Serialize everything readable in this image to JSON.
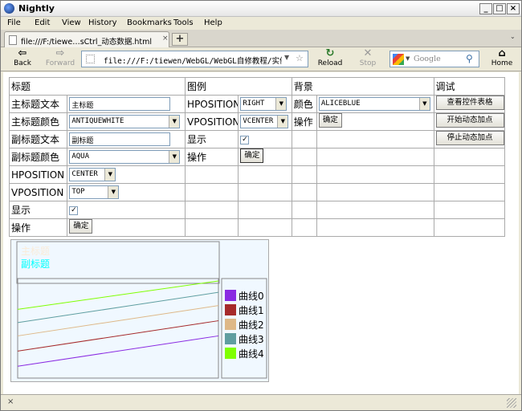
{
  "window": {
    "title": "Nightly",
    "min": "_",
    "max": "□",
    "close": "×"
  },
  "menu": [
    "File",
    "Edit",
    "View",
    "History",
    "Bookmarks",
    "Tools",
    "Help"
  ],
  "tab": {
    "title": "file:///F:/tiewe…sCtrl_动态数据.html",
    "close": "×",
    "new": "+",
    "list": "⌄"
  },
  "nav": {
    "back": "Back",
    "forward": "Forward",
    "reload": "Reload",
    "stop": "Stop",
    "home": "Home",
    "url": "file:///F:/tiewen/WebGL/WebGL自修教程/实例/C",
    "search_placeholder": "Google"
  },
  "headers": {
    "title": "标题",
    "legend": "图例",
    "background": "背景",
    "debug": "调试"
  },
  "title_rows": {
    "main_text_label": "主标题文本",
    "main_text_value": "主标题",
    "main_color_label": "主标题颜色",
    "main_color_value": "ANTIQUEWHITE",
    "sub_text_label": "副标题文本",
    "sub_text_value": "副标题",
    "sub_color_label": "副标题颜色",
    "sub_color_value": "AQUA",
    "hpos_label": "HPOSITION",
    "hpos_value": "CENTER",
    "vpos_label": "VPOSITION",
    "vpos_value": "TOP",
    "show_label": "显示",
    "show_checked": true,
    "op_label": "操作",
    "op_button": "确定"
  },
  "legend_rows": {
    "hpos_label": "HPOSITION",
    "hpos_value": "RIGHT",
    "vpos_label": "VPOSITION",
    "vpos_value": "VCENTER",
    "show_label": "显示",
    "show_checked": true,
    "op_label": "操作",
    "op_button": "确定"
  },
  "background_rows": {
    "color_label": "颜色",
    "color_value": "ALICEBLUE",
    "op_label": "操作",
    "op_button": "确定"
  },
  "debug_buttons": [
    "查看控件表格",
    "开始动态加点",
    "停止动态加点"
  ],
  "status": {
    "close": "×"
  },
  "colors": {
    "chart_bg": "#f0f8ff",
    "title_color": "#faebd7",
    "subtitle_color": "#00ffff"
  },
  "chart_data": {
    "type": "line",
    "title": "主标题",
    "subtitle": "副标题",
    "legend_position": "right",
    "x": [
      0,
      1
    ],
    "ylim": [
      0,
      10
    ],
    "series": [
      {
        "name": "曲线0",
        "color": "#8a2be2",
        "values": [
          1.0,
          4.2
        ]
      },
      {
        "name": "曲线1",
        "color": "#a52a2a",
        "values": [
          2.6,
          5.8
        ]
      },
      {
        "name": "曲线2",
        "color": "#deb887",
        "values": [
          4.2,
          7.4
        ]
      },
      {
        "name": "曲线3",
        "color": "#5f9ea0",
        "values": [
          5.6,
          8.8
        ]
      },
      {
        "name": "曲线4",
        "color": "#7fff00",
        "values": [
          7.0,
          10.0
        ]
      }
    ]
  }
}
